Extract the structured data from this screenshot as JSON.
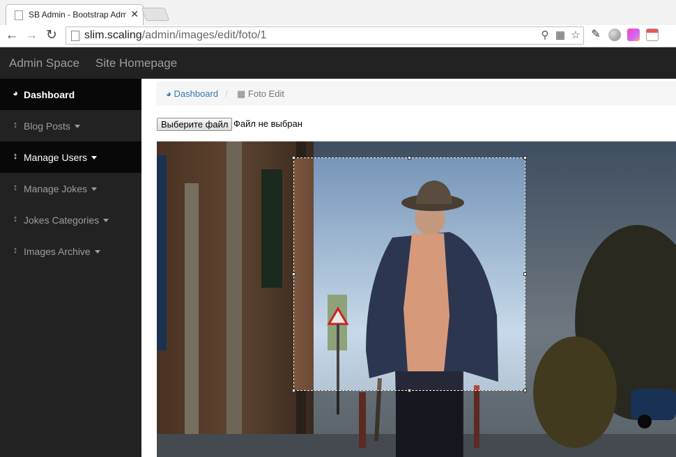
{
  "browser": {
    "tab_title": "SB Admin - Bootstrap Admi",
    "tab_close": "✕",
    "url_host": "slim.scaling",
    "url_path": "/admin/images/edit/foto/1"
  },
  "navbar": {
    "brand": "Admin Space",
    "home_link": "Site Homepage"
  },
  "sidebar": {
    "items": [
      {
        "label": "Dashboard",
        "icon": "dashboard-icon",
        "active": true
      },
      {
        "label": "Blog Posts",
        "icon": "sort-icon",
        "active": false
      },
      {
        "label": "Manage Users",
        "icon": "sort-icon",
        "active": true
      },
      {
        "label": "Manage Jokes",
        "icon": "sort-icon",
        "active": false
      },
      {
        "label": "Jokes Categories",
        "icon": "sort-icon",
        "active": false
      },
      {
        "label": "Images Archive",
        "icon": "sort-icon",
        "active": false
      }
    ]
  },
  "breadcrumb": {
    "dashboard": "Dashboard",
    "separator": "/",
    "current": "Foto Edit"
  },
  "upload": {
    "button_label": "Выберите файл",
    "status": "Файл не выбран"
  },
  "colors": {
    "navbar_bg": "#222222",
    "sidebar_active_bg": "#080808",
    "link": "#337ab7"
  }
}
